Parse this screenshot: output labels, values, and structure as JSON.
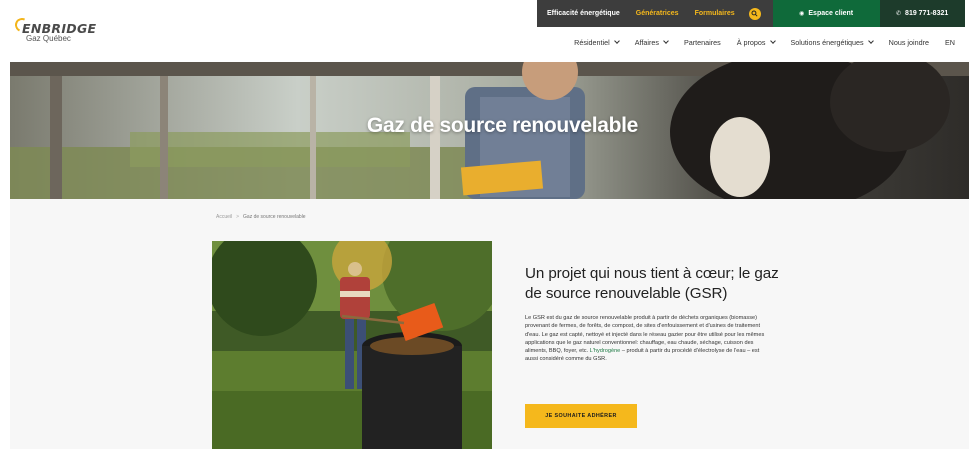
{
  "logo": {
    "brand": "ENBRIDGE",
    "sub": "Gaz Québec"
  },
  "topbar": {
    "links": [
      "Efficacité énergétique",
      "Génératrices",
      "Formulaires"
    ],
    "client_label": "Espace client",
    "phone": "819 771-8321"
  },
  "nav": {
    "items": [
      {
        "label": "Résidentiel",
        "dropdown": true
      },
      {
        "label": "Affaires",
        "dropdown": true
      },
      {
        "label": "Partenaires",
        "dropdown": false
      },
      {
        "label": "À propos",
        "dropdown": true
      },
      {
        "label": "Solutions énergétiques",
        "dropdown": true
      },
      {
        "label": "Nous joindre",
        "dropdown": false
      },
      {
        "label": "EN",
        "dropdown": false
      }
    ]
  },
  "hero": {
    "title": "Gaz de source renouvelable"
  },
  "breadcrumb": {
    "home": "Accueil",
    "current": "Gaz de source renouvelable"
  },
  "main": {
    "heading": "Un projet qui nous tient à cœur; le gaz de source renouvelable (GSR)",
    "body_before": "Le GSR est du gaz de source renouvelable produit à partir de déchets organiques (biomasse) provenant de fermes, de forêts, de compost, de sites d'enfouissement et d'usines de traitement d'eau. Le gaz est capté, nettoyé et injecté dans le réseau gazier pour être utilisé pour les mêmes applications que le gaz naturel conventionnel: chauffage, eau chaude, séchage, cuisson des aliments, BBQ, foyer, etc. ",
    "body_link": "L'hydrogène",
    "body_after": " – produit à partir du procédé d'électrolyse de l'eau – est aussi considéré comme du GSR.",
    "cta_label": "JE SOUHAITE ADHÉRER"
  },
  "colors": {
    "accent_yellow": "#f5b81c",
    "topbar_grey": "#3d3d3d",
    "client_green": "#0f6a3a",
    "phone_dark": "#1d3b2b",
    "link_green": "#1f7a45"
  },
  "icons": [
    "search-icon",
    "user-icon",
    "phone-icon",
    "chevron-down-icon"
  ]
}
